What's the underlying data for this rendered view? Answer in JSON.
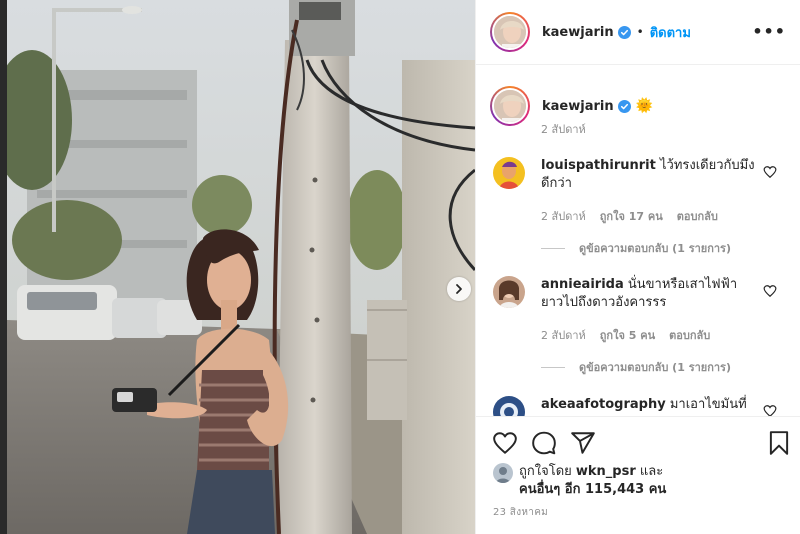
{
  "post": {
    "username": "kaewjarin",
    "follow_label": "ติดตาม",
    "separator": "•",
    "more_label": "•••"
  },
  "caption": {
    "username": "kaewjarin",
    "emoji": "🌞",
    "time": "2 สัปดาห์"
  },
  "comments": [
    {
      "username": "louispathirunrit",
      "text": "ไว้ทรงเดียวกับมึงดีกว่า",
      "time": "2 สัปดาห์",
      "likes": "ถูกใจ 17 คน",
      "reply": "ตอบกลับ",
      "view_replies": "ดูข้อความตอบกลับ (1 รายการ)"
    },
    {
      "username": "annieairida",
      "text": "นั่นขาหรือเสาไฟฟ้า ยาวไปถึงดาวอังคารรร",
      "time": "2 สัปดาห์",
      "likes": "ถูกใจ 5 คน",
      "reply": "ตอบกลับ",
      "view_replies": "ดูข้อความตอบกลับ (1 รายการ)"
    },
    {
      "username": "akeaafotography",
      "text": "มาเอาไขมันที่แอ"
    }
  ],
  "likes": {
    "prefix": "ถูกใจโดย",
    "user": "wkn_psr",
    "and": "และ",
    "others": "คนอื่นๆ อีก 115,443 คน"
  },
  "date": "23 สิงหาคม",
  "colors": {
    "link_blue": "#0095f6",
    "verified_blue": "#3897f0",
    "muted": "#8e8e8e",
    "border": "#efefef"
  }
}
